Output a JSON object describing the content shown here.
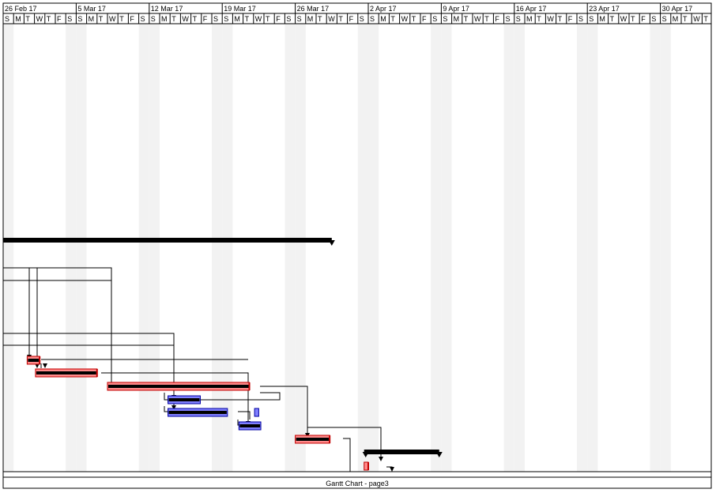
{
  "timescale": {
    "weeks": [
      "26 Feb 17",
      "5 Mar 17",
      "12 Mar 17",
      "19 Mar 17",
      "26 Mar 17",
      "2 Apr 17",
      "9 Apr 17",
      "16 Apr 17",
      "23 Apr 17",
      "30 Apr 17"
    ],
    "days": [
      "S",
      "M",
      "T",
      "W",
      "T",
      "F",
      "S"
    ]
  },
  "footer": {
    "label": "Gantt Chart  -  page3"
  },
  "colors": {
    "critical_fill": "#ff8a8a",
    "critical_border": "#c00000",
    "normal_fill": "#8080ff",
    "normal_border": "#0000a0",
    "summary": "#000000",
    "weekend_shade": "#f2f2f2",
    "grid_line": "#000000"
  },
  "tasks": [
    {
      "type": "summary",
      "start_day": 0,
      "end_day": 31.5
    },
    {
      "type": "critical",
      "start_day": 2.3,
      "end_day": 3.5
    },
    {
      "type": "critical",
      "start_day": 3.1,
      "end_day": 9.0
    },
    {
      "type": "critical",
      "start_day": 10.0,
      "end_day": 23.6
    },
    {
      "type": "normal",
      "start_day": 15.8,
      "end_day": 18.9
    },
    {
      "type": "normal",
      "start_day": 15.8,
      "end_day": 21.5
    },
    {
      "type": "normal",
      "start_day": 24.1,
      "end_day": 24.5
    },
    {
      "type": "normal",
      "start_day": 22.6,
      "end_day": 24.7
    },
    {
      "type": "critical",
      "start_day": 28.0,
      "end_day": 31.3
    },
    {
      "type": "summary",
      "start_day": 34.6,
      "end_day": 41.8
    },
    {
      "type": "critical",
      "start_day": 34.6,
      "end_day": 35.0
    }
  ]
}
